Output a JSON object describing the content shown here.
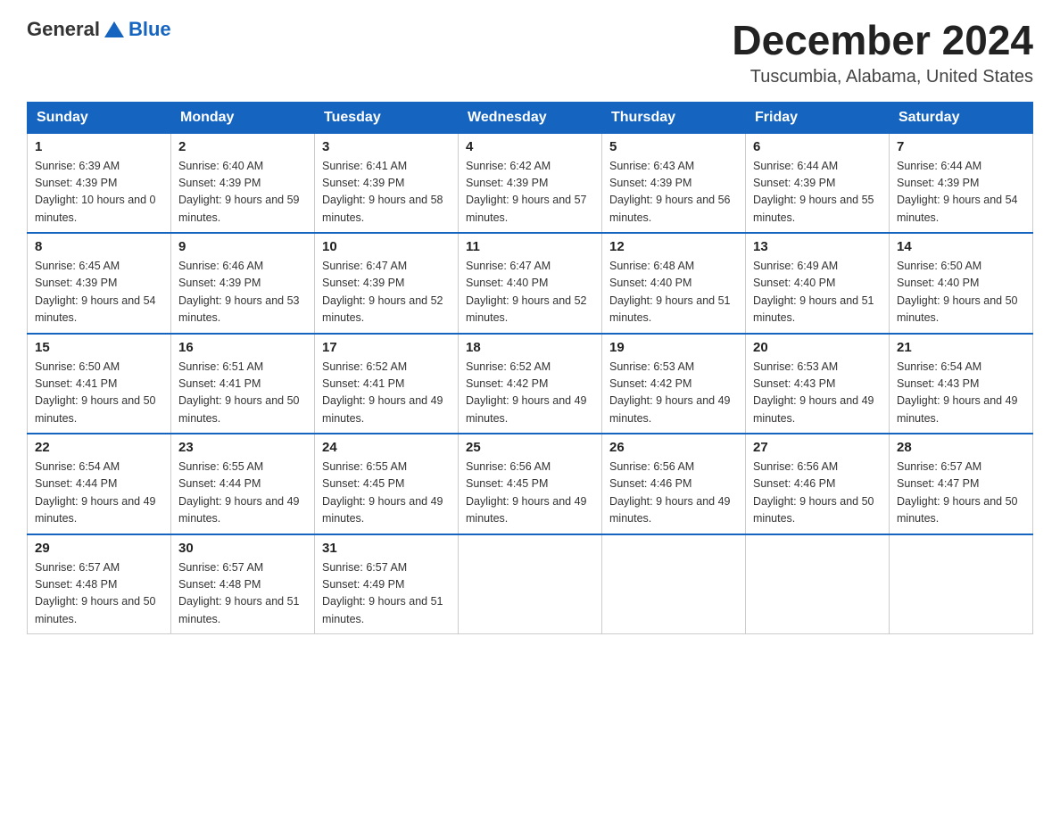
{
  "logo": {
    "general": "General",
    "blue": "Blue"
  },
  "title": "December 2024",
  "subtitle": "Tuscumbia, Alabama, United States",
  "headers": [
    "Sunday",
    "Monday",
    "Tuesday",
    "Wednesday",
    "Thursday",
    "Friday",
    "Saturday"
  ],
  "weeks": [
    [
      {
        "day": "1",
        "sunrise": "6:39 AM",
        "sunset": "4:39 PM",
        "daylight": "10 hours and 0 minutes."
      },
      {
        "day": "2",
        "sunrise": "6:40 AM",
        "sunset": "4:39 PM",
        "daylight": "9 hours and 59 minutes."
      },
      {
        "day": "3",
        "sunrise": "6:41 AM",
        "sunset": "4:39 PM",
        "daylight": "9 hours and 58 minutes."
      },
      {
        "day": "4",
        "sunrise": "6:42 AM",
        "sunset": "4:39 PM",
        "daylight": "9 hours and 57 minutes."
      },
      {
        "day": "5",
        "sunrise": "6:43 AM",
        "sunset": "4:39 PM",
        "daylight": "9 hours and 56 minutes."
      },
      {
        "day": "6",
        "sunrise": "6:44 AM",
        "sunset": "4:39 PM",
        "daylight": "9 hours and 55 minutes."
      },
      {
        "day": "7",
        "sunrise": "6:44 AM",
        "sunset": "4:39 PM",
        "daylight": "9 hours and 54 minutes."
      }
    ],
    [
      {
        "day": "8",
        "sunrise": "6:45 AM",
        "sunset": "4:39 PM",
        "daylight": "9 hours and 54 minutes."
      },
      {
        "day": "9",
        "sunrise": "6:46 AM",
        "sunset": "4:39 PM",
        "daylight": "9 hours and 53 minutes."
      },
      {
        "day": "10",
        "sunrise": "6:47 AM",
        "sunset": "4:39 PM",
        "daylight": "9 hours and 52 minutes."
      },
      {
        "day": "11",
        "sunrise": "6:47 AM",
        "sunset": "4:40 PM",
        "daylight": "9 hours and 52 minutes."
      },
      {
        "day": "12",
        "sunrise": "6:48 AM",
        "sunset": "4:40 PM",
        "daylight": "9 hours and 51 minutes."
      },
      {
        "day": "13",
        "sunrise": "6:49 AM",
        "sunset": "4:40 PM",
        "daylight": "9 hours and 51 minutes."
      },
      {
        "day": "14",
        "sunrise": "6:50 AM",
        "sunset": "4:40 PM",
        "daylight": "9 hours and 50 minutes."
      }
    ],
    [
      {
        "day": "15",
        "sunrise": "6:50 AM",
        "sunset": "4:41 PM",
        "daylight": "9 hours and 50 minutes."
      },
      {
        "day": "16",
        "sunrise": "6:51 AM",
        "sunset": "4:41 PM",
        "daylight": "9 hours and 50 minutes."
      },
      {
        "day": "17",
        "sunrise": "6:52 AM",
        "sunset": "4:41 PM",
        "daylight": "9 hours and 49 minutes."
      },
      {
        "day": "18",
        "sunrise": "6:52 AM",
        "sunset": "4:42 PM",
        "daylight": "9 hours and 49 minutes."
      },
      {
        "day": "19",
        "sunrise": "6:53 AM",
        "sunset": "4:42 PM",
        "daylight": "9 hours and 49 minutes."
      },
      {
        "day": "20",
        "sunrise": "6:53 AM",
        "sunset": "4:43 PM",
        "daylight": "9 hours and 49 minutes."
      },
      {
        "day": "21",
        "sunrise": "6:54 AM",
        "sunset": "4:43 PM",
        "daylight": "9 hours and 49 minutes."
      }
    ],
    [
      {
        "day": "22",
        "sunrise": "6:54 AM",
        "sunset": "4:44 PM",
        "daylight": "9 hours and 49 minutes."
      },
      {
        "day": "23",
        "sunrise": "6:55 AM",
        "sunset": "4:44 PM",
        "daylight": "9 hours and 49 minutes."
      },
      {
        "day": "24",
        "sunrise": "6:55 AM",
        "sunset": "4:45 PM",
        "daylight": "9 hours and 49 minutes."
      },
      {
        "day": "25",
        "sunrise": "6:56 AM",
        "sunset": "4:45 PM",
        "daylight": "9 hours and 49 minutes."
      },
      {
        "day": "26",
        "sunrise": "6:56 AM",
        "sunset": "4:46 PM",
        "daylight": "9 hours and 49 minutes."
      },
      {
        "day": "27",
        "sunrise": "6:56 AM",
        "sunset": "4:46 PM",
        "daylight": "9 hours and 50 minutes."
      },
      {
        "day": "28",
        "sunrise": "6:57 AM",
        "sunset": "4:47 PM",
        "daylight": "9 hours and 50 minutes."
      }
    ],
    [
      {
        "day": "29",
        "sunrise": "6:57 AM",
        "sunset": "4:48 PM",
        "daylight": "9 hours and 50 minutes."
      },
      {
        "day": "30",
        "sunrise": "6:57 AM",
        "sunset": "4:48 PM",
        "daylight": "9 hours and 51 minutes."
      },
      {
        "day": "31",
        "sunrise": "6:57 AM",
        "sunset": "4:49 PM",
        "daylight": "9 hours and 51 minutes."
      },
      null,
      null,
      null,
      null
    ]
  ],
  "labels": {
    "sunrise_prefix": "Sunrise: ",
    "sunset_prefix": "Sunset: ",
    "daylight_prefix": "Daylight: "
  }
}
